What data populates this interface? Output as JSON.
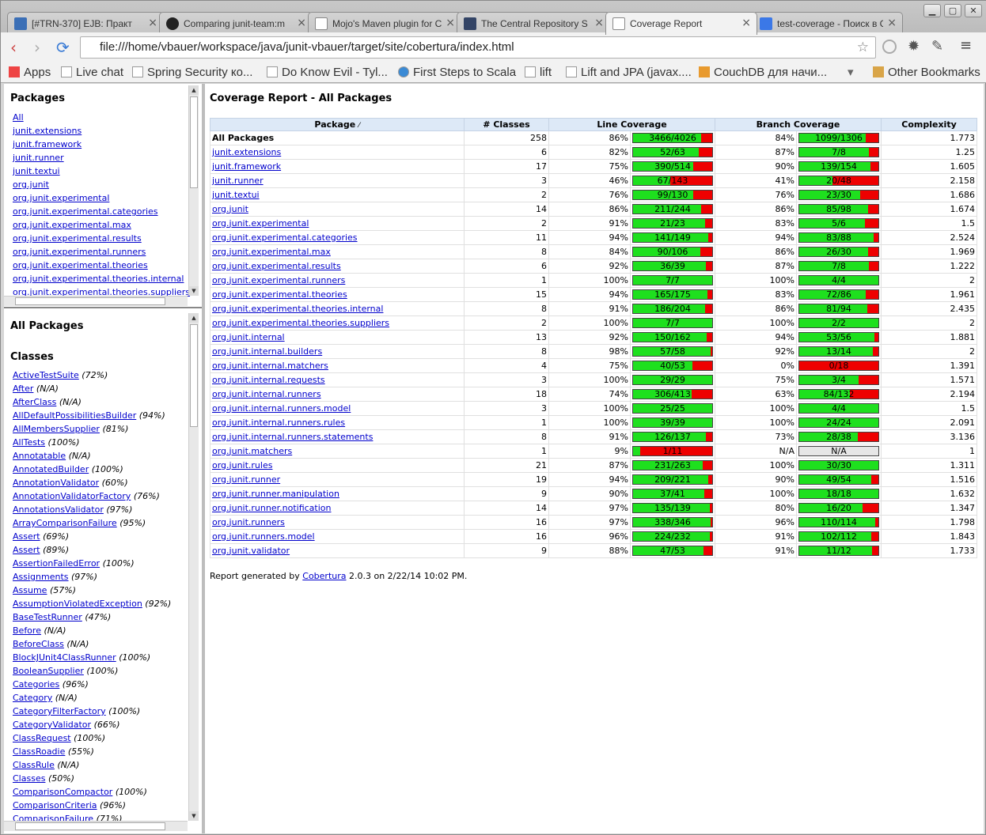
{
  "tabs": [
    {
      "title": "[#TRN-370] EJB: Практ",
      "icon": "jira-icon",
      "color": "#3b6fb6"
    },
    {
      "title": "Comparing junit-team:m",
      "icon": "github-icon",
      "color": "#222222"
    },
    {
      "title": "Mojo's Maven plugin for C",
      "icon": "page-icon",
      "color": "#ffffff"
    },
    {
      "title": "The Central Repository S",
      "icon": "maven-icon",
      "color": "#334466"
    },
    {
      "title": "Coverage Report",
      "icon": "page-icon",
      "color": "#ffffff"
    },
    {
      "title": "test-coverage - Поиск в G",
      "icon": "google-icon",
      "color": "#3b78e7"
    }
  ],
  "window_buttons": {
    "minimize": "▁",
    "maximize": "▢",
    "close": "✕"
  },
  "nav": {
    "back": "‹",
    "forward": "›",
    "reload": "⟳"
  },
  "url": "file:///home/vbauer/workspace/java/junit-vbauer/target/site/cobertura/index.html",
  "bookmarks": [
    {
      "label": "Apps"
    },
    {
      "label": "Live chat"
    },
    {
      "label": "Spring Security ко..."
    },
    {
      "label": "Do Know Evil - Tyl..."
    },
    {
      "label": "First Steps to Scala"
    },
    {
      "label": "lift"
    },
    {
      "label": "Lift and JPA (javax...."
    },
    {
      "label": "CouchDB для начи..."
    }
  ],
  "other_bookmarks": "Other Bookmarks",
  "packages_frame": {
    "title": "Packages",
    "items": [
      "All",
      "junit.extensions",
      "junit.framework",
      "junit.runner",
      "junit.textui",
      "org.junit",
      "org.junit.experimental",
      "org.junit.experimental.categories",
      "org.junit.experimental.max",
      "org.junit.experimental.results",
      "org.junit.experimental.runners",
      "org.junit.experimental.theories",
      "org.junit.experimental.theories.internal",
      "org.junit.experimental.theories.suppliers"
    ]
  },
  "classes_frame": {
    "title": "All Packages",
    "subtitle": "Classes",
    "items": [
      {
        "name": "ActiveTestSuite",
        "pct": "(72%)"
      },
      {
        "name": "After",
        "pct": "(N/A)"
      },
      {
        "name": "AfterClass",
        "pct": "(N/A)"
      },
      {
        "name": "AllDefaultPossibilitiesBuilder",
        "pct": "(94%)"
      },
      {
        "name": "AllMembersSupplier",
        "pct": "(81%)"
      },
      {
        "name": "AllTests",
        "pct": "(100%)"
      },
      {
        "name": "Annotatable",
        "pct": "(N/A)"
      },
      {
        "name": "AnnotatedBuilder",
        "pct": "(100%)"
      },
      {
        "name": "AnnotationValidator",
        "pct": "(60%)"
      },
      {
        "name": "AnnotationValidatorFactory",
        "pct": "(76%)"
      },
      {
        "name": "AnnotationsValidator",
        "pct": "(97%)"
      },
      {
        "name": "ArrayComparisonFailure",
        "pct": "(95%)"
      },
      {
        "name": "Assert",
        "pct": "(69%)"
      },
      {
        "name": "Assert",
        "pct": "(89%)"
      },
      {
        "name": "AssertionFailedError",
        "pct": "(100%)"
      },
      {
        "name": "Assignments",
        "pct": "(97%)"
      },
      {
        "name": "Assume",
        "pct": "(57%)"
      },
      {
        "name": "AssumptionViolatedException",
        "pct": "(92%)"
      },
      {
        "name": "BaseTestRunner",
        "pct": "(47%)"
      },
      {
        "name": "Before",
        "pct": "(N/A)"
      },
      {
        "name": "BeforeClass",
        "pct": "(N/A)"
      },
      {
        "name": "BlockJUnit4ClassRunner",
        "pct": "(100%)"
      },
      {
        "name": "BooleanSupplier",
        "pct": "(100%)"
      },
      {
        "name": "Categories",
        "pct": "(96%)"
      },
      {
        "name": "Category",
        "pct": "(N/A)"
      },
      {
        "name": "CategoryFilterFactory",
        "pct": "(100%)"
      },
      {
        "name": "CategoryValidator",
        "pct": "(66%)"
      },
      {
        "name": "ClassRequest",
        "pct": "(100%)"
      },
      {
        "name": "ClassRoadie",
        "pct": "(55%)"
      },
      {
        "name": "ClassRule",
        "pct": "(N/A)"
      },
      {
        "name": "Classes",
        "pct": "(50%)"
      },
      {
        "name": "ComparisonCompactor",
        "pct": "(100%)"
      },
      {
        "name": "ComparisonCriteria",
        "pct": "(96%)"
      },
      {
        "name": "ComparisonFailure",
        "pct": "(71%)"
      }
    ]
  },
  "report": {
    "title": "Coverage Report - All Packages",
    "headers": {
      "package": "Package",
      "sort_icon": "⁄",
      "classes": "# Classes",
      "line": "Line Coverage",
      "branch": "Branch Coverage",
      "complexity": "Complexity"
    },
    "rows": [
      {
        "pkg": "All Packages",
        "link": false,
        "classes": "258",
        "lp": "86%",
        "lc": 3466,
        "lt": 4026,
        "bp": "84%",
        "bc": 1099,
        "bt": 1306,
        "cx": "1.773"
      },
      {
        "pkg": "junit.extensions",
        "link": true,
        "classes": "6",
        "lp": "82%",
        "lc": 52,
        "lt": 63,
        "bp": "87%",
        "bc": 7,
        "bt": 8,
        "cx": "1.25"
      },
      {
        "pkg": "junit.framework",
        "link": true,
        "classes": "17",
        "lp": "75%",
        "lc": 390,
        "lt": 514,
        "bp": "90%",
        "bc": 139,
        "bt": 154,
        "cx": "1.605"
      },
      {
        "pkg": "junit.runner",
        "link": true,
        "classes": "3",
        "lp": "46%",
        "lc": 67,
        "lt": 143,
        "bp": "41%",
        "bc": 20,
        "bt": 48,
        "cx": "2.158"
      },
      {
        "pkg": "junit.textui",
        "link": true,
        "classes": "2",
        "lp": "76%",
        "lc": 99,
        "lt": 130,
        "bp": "76%",
        "bc": 23,
        "bt": 30,
        "cx": "1.686"
      },
      {
        "pkg": "org.junit",
        "link": true,
        "classes": "14",
        "lp": "86%",
        "lc": 211,
        "lt": 244,
        "bp": "86%",
        "bc": 85,
        "bt": 98,
        "cx": "1.674"
      },
      {
        "pkg": "org.junit.experimental",
        "link": true,
        "classes": "2",
        "lp": "91%",
        "lc": 21,
        "lt": 23,
        "bp": "83%",
        "bc": 5,
        "bt": 6,
        "cx": "1.5"
      },
      {
        "pkg": "org.junit.experimental.categories",
        "link": true,
        "classes": "11",
        "lp": "94%",
        "lc": 141,
        "lt": 149,
        "bp": "94%",
        "bc": 83,
        "bt": 88,
        "cx": "2.524"
      },
      {
        "pkg": "org.junit.experimental.max",
        "link": true,
        "classes": "8",
        "lp": "84%",
        "lc": 90,
        "lt": 106,
        "bp": "86%",
        "bc": 26,
        "bt": 30,
        "cx": "1.969"
      },
      {
        "pkg": "org.junit.experimental.results",
        "link": true,
        "classes": "6",
        "lp": "92%",
        "lc": 36,
        "lt": 39,
        "bp": "87%",
        "bc": 7,
        "bt": 8,
        "cx": "1.222"
      },
      {
        "pkg": "org.junit.experimental.runners",
        "link": true,
        "classes": "1",
        "lp": "100%",
        "lc": 7,
        "lt": 7,
        "bp": "100%",
        "bc": 4,
        "bt": 4,
        "cx": "2"
      },
      {
        "pkg": "org.junit.experimental.theories",
        "link": true,
        "classes": "15",
        "lp": "94%",
        "lc": 165,
        "lt": 175,
        "bp": "83%",
        "bc": 72,
        "bt": 86,
        "cx": "1.961"
      },
      {
        "pkg": "org.junit.experimental.theories.internal",
        "link": true,
        "classes": "8",
        "lp": "91%",
        "lc": 186,
        "lt": 204,
        "bp": "86%",
        "bc": 81,
        "bt": 94,
        "cx": "2.435"
      },
      {
        "pkg": "org.junit.experimental.theories.suppliers",
        "link": true,
        "classes": "2",
        "lp": "100%",
        "lc": 7,
        "lt": 7,
        "bp": "100%",
        "bc": 2,
        "bt": 2,
        "cx": "2"
      },
      {
        "pkg": "org.junit.internal",
        "link": true,
        "classes": "13",
        "lp": "92%",
        "lc": 150,
        "lt": 162,
        "bp": "94%",
        "bc": 53,
        "bt": 56,
        "cx": "1.881"
      },
      {
        "pkg": "org.junit.internal.builders",
        "link": true,
        "classes": "8",
        "lp": "98%",
        "lc": 57,
        "lt": 58,
        "bp": "92%",
        "bc": 13,
        "bt": 14,
        "cx": "2"
      },
      {
        "pkg": "org.junit.internal.matchers",
        "link": true,
        "classes": "4",
        "lp": "75%",
        "lc": 40,
        "lt": 53,
        "bp": "0%",
        "bc": 0,
        "bt": 18,
        "cx": "1.391"
      },
      {
        "pkg": "org.junit.internal.requests",
        "link": true,
        "classes": "3",
        "lp": "100%",
        "lc": 29,
        "lt": 29,
        "bp": "75%",
        "bc": 3,
        "bt": 4,
        "cx": "1.571"
      },
      {
        "pkg": "org.junit.internal.runners",
        "link": true,
        "classes": "18",
        "lp": "74%",
        "lc": 306,
        "lt": 413,
        "bp": "63%",
        "bc": 84,
        "bt": 132,
        "cx": "2.194"
      },
      {
        "pkg": "org.junit.internal.runners.model",
        "link": true,
        "classes": "3",
        "lp": "100%",
        "lc": 25,
        "lt": 25,
        "bp": "100%",
        "bc": 4,
        "bt": 4,
        "cx": "1.5"
      },
      {
        "pkg": "org.junit.internal.runners.rules",
        "link": true,
        "classes": "1",
        "lp": "100%",
        "lc": 39,
        "lt": 39,
        "bp": "100%",
        "bc": 24,
        "bt": 24,
        "cx": "2.091"
      },
      {
        "pkg": "org.junit.internal.runners.statements",
        "link": true,
        "classes": "8",
        "lp": "91%",
        "lc": 126,
        "lt": 137,
        "bp": "73%",
        "bc": 28,
        "bt": 38,
        "cx": "3.136"
      },
      {
        "pkg": "org.junit.matchers",
        "link": true,
        "classes": "1",
        "lp": "9%",
        "lc": 1,
        "lt": 11,
        "bp": "N/A",
        "bc": null,
        "bt": null,
        "btext": "N/A",
        "cx": "1"
      },
      {
        "pkg": "org.junit.rules",
        "link": true,
        "classes": "21",
        "lp": "87%",
        "lc": 231,
        "lt": 263,
        "bp": "100%",
        "bc": 30,
        "bt": 30,
        "cx": "1.311"
      },
      {
        "pkg": "org.junit.runner",
        "link": true,
        "classes": "19",
        "lp": "94%",
        "lc": 209,
        "lt": 221,
        "bp": "90%",
        "bc": 49,
        "bt": 54,
        "cx": "1.516"
      },
      {
        "pkg": "org.junit.runner.manipulation",
        "link": true,
        "classes": "9",
        "lp": "90%",
        "lc": 37,
        "lt": 41,
        "bp": "100%",
        "bc": 18,
        "bt": 18,
        "cx": "1.632"
      },
      {
        "pkg": "org.junit.runner.notification",
        "link": true,
        "classes": "14",
        "lp": "97%",
        "lc": 135,
        "lt": 139,
        "bp": "80%",
        "bc": 16,
        "bt": 20,
        "cx": "1.347"
      },
      {
        "pkg": "org.junit.runners",
        "link": true,
        "classes": "16",
        "lp": "97%",
        "lc": 338,
        "lt": 346,
        "bp": "96%",
        "bc": 110,
        "bt": 114,
        "cx": "1.798"
      },
      {
        "pkg": "org.junit.runners.model",
        "link": true,
        "classes": "16",
        "lp": "96%",
        "lc": 224,
        "lt": 232,
        "bp": "91%",
        "bc": 102,
        "bt": 112,
        "cx": "1.843"
      },
      {
        "pkg": "org.junit.validator",
        "link": true,
        "classes": "9",
        "lp": "88%",
        "lc": 47,
        "lt": 53,
        "bp": "91%",
        "bc": 11,
        "bt": 12,
        "cx": "1.733"
      }
    ],
    "footer": {
      "prefix": "Report generated by ",
      "link": "Cobertura",
      "suffix": " 2.0.3 on 2/22/14 10:02 PM."
    }
  },
  "colors": {
    "covered": "#1ee01e",
    "uncovered": "#ee0000",
    "link": "#0000cc",
    "header_bg": "#dde9f7"
  }
}
